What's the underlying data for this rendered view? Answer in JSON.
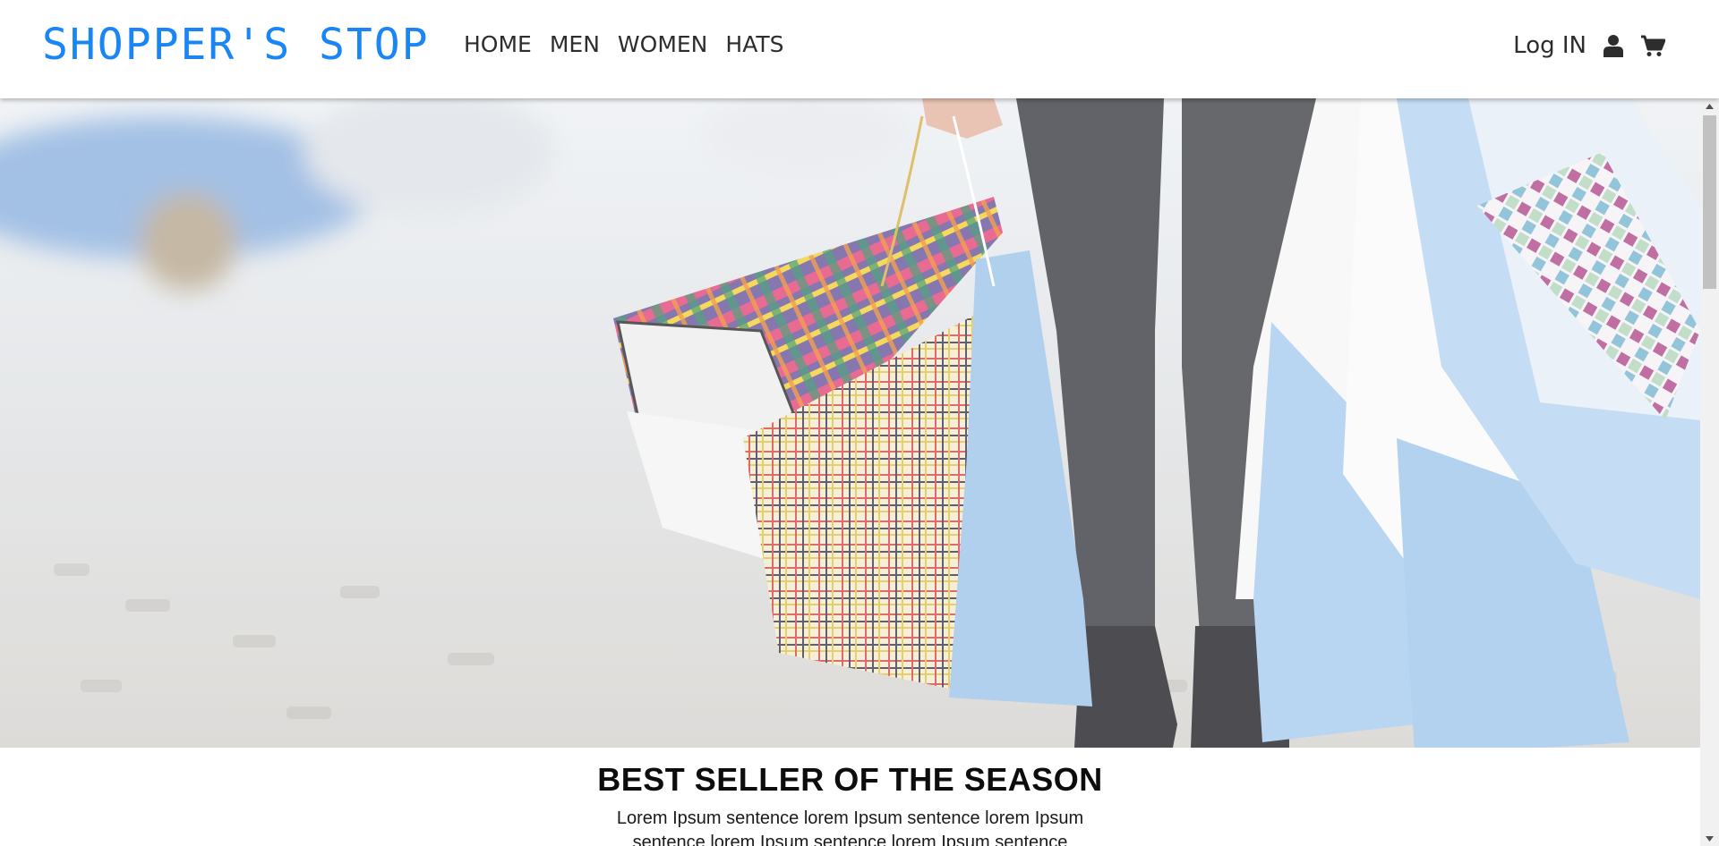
{
  "header": {
    "brand": "SHOPPER'S STOP",
    "brand_color": "#1a86f5",
    "nav": [
      {
        "label": "HOME"
      },
      {
        "label": "MEN"
      },
      {
        "label": "WOMEN"
      },
      {
        "label": "HATS"
      }
    ],
    "login_label": "Log IN",
    "user_icon": "user-icon",
    "cart_icon": "cart-icon"
  },
  "hero": {
    "image": "shopping-bags-photo"
  },
  "section": {
    "title": "BEST SELLER OF THE SEASON",
    "text": "Lorem Ipsum sentence lorem Ipsum sentence lorem Ipsum sentence lorem Ipsum sentence lorem Ipsum sentence"
  },
  "scrollbar": {
    "up_icon": "triangle-up-icon",
    "down_icon": "triangle-down-icon"
  }
}
